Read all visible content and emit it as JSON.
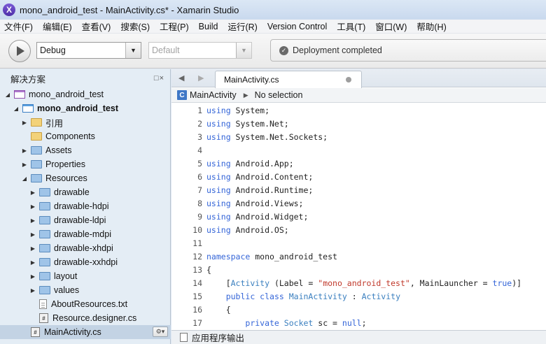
{
  "window": {
    "title": "mono_android_test - MainActivity.cs* - Xamarin Studio",
    "app_icon_letter": "X"
  },
  "menu": [
    "文件(F)",
    "编辑(E)",
    "查看(V)",
    "搜索(S)",
    "工程(P)",
    "Build",
    "运行(R)",
    "Version Control",
    "工具(T)",
    "窗口(W)",
    "帮助(H)"
  ],
  "toolbar": {
    "config": "Debug",
    "target": "Default",
    "status": "Deployment completed"
  },
  "solution_panel": {
    "title": "解决方案",
    "header_icons": "□×",
    "items": [
      {
        "label": "mono_android_test",
        "icon": "solution-icon",
        "depth": 0,
        "expand": "open",
        "bold": false
      },
      {
        "label": "mono_android_test",
        "icon": "project-icon",
        "depth": 1,
        "expand": "open",
        "bold": true
      },
      {
        "label": "引用",
        "icon": "folder-icon",
        "depth": 2,
        "expand": "closed",
        "bold": false,
        "yellow": true
      },
      {
        "label": "Components",
        "icon": "folder-icon",
        "depth": 2,
        "expand": "none",
        "bold": false,
        "yellow": true
      },
      {
        "label": "Assets",
        "icon": "folder-icon",
        "depth": 2,
        "expand": "closed",
        "bold": false
      },
      {
        "label": "Properties",
        "icon": "folder-icon",
        "depth": 2,
        "expand": "closed",
        "bold": false
      },
      {
        "label": "Resources",
        "icon": "folder-icon",
        "depth": 2,
        "expand": "open",
        "bold": false
      },
      {
        "label": "drawable",
        "icon": "folder-icon",
        "depth": 3,
        "expand": "closed",
        "bold": false
      },
      {
        "label": "drawable-hdpi",
        "icon": "folder-icon",
        "depth": 3,
        "expand": "closed",
        "bold": false
      },
      {
        "label": "drawable-ldpi",
        "icon": "folder-icon",
        "depth": 3,
        "expand": "closed",
        "bold": false
      },
      {
        "label": "drawable-mdpi",
        "icon": "folder-icon",
        "depth": 3,
        "expand": "closed",
        "bold": false
      },
      {
        "label": "drawable-xhdpi",
        "icon": "folder-icon",
        "depth": 3,
        "expand": "closed",
        "bold": false
      },
      {
        "label": "drawable-xxhdpi",
        "icon": "folder-icon",
        "depth": 3,
        "expand": "closed",
        "bold": false
      },
      {
        "label": "layout",
        "icon": "folder-icon",
        "depth": 3,
        "expand": "closed",
        "bold": false
      },
      {
        "label": "values",
        "icon": "folder-icon",
        "depth": 3,
        "expand": "closed",
        "bold": false
      },
      {
        "label": "AboutResources.txt",
        "icon": "text-file-icon",
        "depth": 3,
        "expand": "none",
        "bold": false
      },
      {
        "label": "Resource.designer.cs",
        "icon": "cs-file-icon",
        "depth": 3,
        "expand": "none",
        "bold": false
      },
      {
        "label": "MainActivity.cs",
        "icon": "cs-file-icon",
        "depth": 2,
        "expand": "none",
        "bold": false,
        "selected": true
      }
    ]
  },
  "editor": {
    "tab_label": "MainActivity.cs",
    "path_class": "MainActivity",
    "path_class_icon": "C",
    "path_member": "No selection",
    "lines": [
      {
        "n": "1",
        "t": [
          [
            "kw",
            "using"
          ],
          [
            "p",
            " System;"
          ]
        ]
      },
      {
        "n": "2",
        "t": [
          [
            "kw",
            "using"
          ],
          [
            "p",
            " System.Net;"
          ]
        ]
      },
      {
        "n": "3",
        "t": [
          [
            "kw",
            "using"
          ],
          [
            "p",
            " System.Net.Sockets;"
          ]
        ]
      },
      {
        "n": "4",
        "t": []
      },
      {
        "n": "5",
        "t": [
          [
            "kw",
            "using"
          ],
          [
            "p",
            " Android.App;"
          ]
        ]
      },
      {
        "n": "6",
        "t": [
          [
            "kw",
            "using"
          ],
          [
            "p",
            " Android.Content;"
          ]
        ]
      },
      {
        "n": "7",
        "t": [
          [
            "kw",
            "using"
          ],
          [
            "p",
            " Android.Runtime;"
          ]
        ]
      },
      {
        "n": "8",
        "t": [
          [
            "kw",
            "using"
          ],
          [
            "p",
            " Android.Views;"
          ]
        ]
      },
      {
        "n": "9",
        "t": [
          [
            "kw",
            "using"
          ],
          [
            "p",
            " Android.Widget;"
          ]
        ]
      },
      {
        "n": "10",
        "t": [
          [
            "kw",
            "using"
          ],
          [
            "p",
            " Android.OS;"
          ]
        ]
      },
      {
        "n": "11",
        "t": []
      },
      {
        "n": "12",
        "t": [
          [
            "kw",
            "namespace"
          ],
          [
            "p",
            " mono_android_test"
          ]
        ]
      },
      {
        "n": "13",
        "t": [
          [
            "p",
            "{"
          ]
        ]
      },
      {
        "n": "14",
        "t": [
          [
            "p",
            "    ["
          ],
          [
            "typ",
            "Activity"
          ],
          [
            "p",
            " (Label = "
          ],
          [
            "str",
            "\"mono_android_test\""
          ],
          [
            "p",
            ", MainLauncher = "
          ],
          [
            "kw",
            "true"
          ],
          [
            "p",
            ")]"
          ]
        ]
      },
      {
        "n": "15",
        "t": [
          [
            "p",
            "    "
          ],
          [
            "kw",
            "public class"
          ],
          [
            "p",
            " "
          ],
          [
            "typ",
            "MainActivity"
          ],
          [
            "p",
            " : "
          ],
          [
            "typ",
            "Activity"
          ]
        ]
      },
      {
        "n": "16",
        "t": [
          [
            "p",
            "    {"
          ]
        ]
      },
      {
        "n": "17",
        "t": [
          [
            "p",
            "        "
          ],
          [
            "kw",
            "private"
          ],
          [
            "p",
            " "
          ],
          [
            "typ",
            "Socket"
          ],
          [
            "p",
            " sc = "
          ],
          [
            "kw",
            "null"
          ],
          [
            "p",
            ";"
          ]
        ]
      }
    ]
  },
  "output_panel": {
    "label": "应用程序输出"
  }
}
